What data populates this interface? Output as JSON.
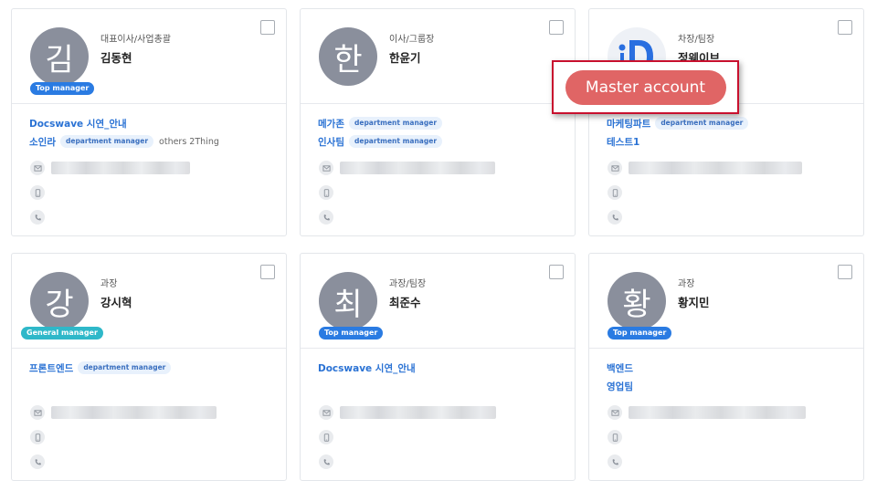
{
  "cards": [
    {
      "avatar": "김",
      "role_badge": "Top manager",
      "position": "대표이사/사업총괄",
      "name": "김동현",
      "departments": [
        {
          "name": "Docswave 시연_안내",
          "manager_tag": ""
        },
        {
          "name": "소인라",
          "manager_tag": "department manager",
          "extra": "others 2Thing"
        }
      ]
    },
    {
      "avatar": "한",
      "role_badge": "",
      "position": "이사/그룹장",
      "name": "한윤기",
      "departments": [
        {
          "name": "메가존",
          "manager_tag": "department manager"
        },
        {
          "name": "인사팀",
          "manager_tag": "department manager"
        }
      ]
    },
    {
      "avatar": "",
      "avatar_icon": "docswave-logo-icon",
      "role_badge": "",
      "position": "차장/팀장",
      "name": "정웨이브",
      "departments": [
        {
          "name": "마케팅파트",
          "manager_tag": "department manager"
        },
        {
          "name": "테스트1",
          "manager_tag": ""
        }
      ]
    },
    {
      "avatar": "강",
      "role_badge": "General manager",
      "position": "과장",
      "name": "강시혁",
      "departments": [
        {
          "name": "프론트엔드",
          "manager_tag": "department manager"
        }
      ]
    },
    {
      "avatar": "최",
      "role_badge": "Top manager",
      "position": "과장/팀장",
      "name": "최준수",
      "departments": [
        {
          "name": "Docswave 시연_안내",
          "manager_tag": ""
        }
      ]
    },
    {
      "avatar": "황",
      "role_badge": "Top manager",
      "position": "과장",
      "name": "황지민",
      "departments": [
        {
          "name": "백엔드",
          "manager_tag": ""
        },
        {
          "name": "영업팀",
          "manager_tag": ""
        }
      ]
    }
  ],
  "contact_icons": {
    "email": "mail-icon",
    "mobile": "mobile-icon",
    "phone": "phone-icon"
  },
  "master_account": {
    "label": "Master account"
  },
  "colors": {
    "link": "#2a72d4",
    "top_manager": "#2a7be2",
    "general_manager": "#2fb8c9",
    "master_pill": "#e06565",
    "popup_border": "#c8102e"
  }
}
